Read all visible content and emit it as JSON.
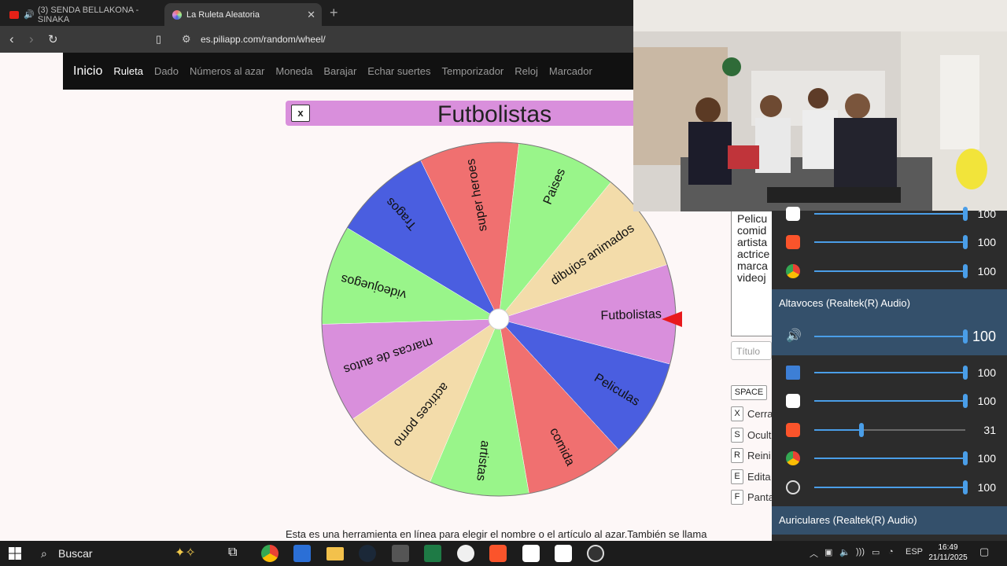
{
  "browser": {
    "tabs": [
      {
        "label": "(3) SENDA BELLAKONA - SINAKA",
        "active": false
      },
      {
        "label": "La Ruleta Aleatoria",
        "active": true
      }
    ],
    "new_tab": "+",
    "url": "es.piliapp.com/random/wheel/"
  },
  "site_nav": {
    "brand": "Inicio",
    "links": [
      "Ruleta",
      "Dado",
      "Números al azar",
      "Moneda",
      "Barajar",
      "Echar suertes",
      "Temporizador",
      "Reloj",
      "Marcador"
    ]
  },
  "wheel": {
    "close_label": "x",
    "title": "Futbolistas",
    "segments": [
      {
        "label": "Futbolistas",
        "color": "#d98fdc"
      },
      {
        "label": "Peliculas",
        "color": "#4a5ee0"
      },
      {
        "label": "comida",
        "color": "#f07070"
      },
      {
        "label": "artistas",
        "color": "#99f58a"
      },
      {
        "label": "actrices porno",
        "color": "#f3dcaa"
      },
      {
        "label": "marcas de autos",
        "color": "#d98fdc"
      },
      {
        "label": "videojuegos",
        "color": "#99f58a"
      },
      {
        "label": "Tragos",
        "color": "#4a5ee0"
      },
      {
        "label": "super heroes",
        "color": "#f07070"
      },
      {
        "label": "Paises",
        "color": "#99f58a"
      },
      {
        "label": "dibujos animados",
        "color": "#f3dcaa"
      }
    ],
    "pointer_color": "#e8191c"
  },
  "description": "Esta es una herramienta en línea para elegir el nombre o el artículo al azar.También se llama",
  "right_panel": {
    "options_text": [
      "Pelicu",
      "comid",
      "artista",
      "actrice",
      "marca",
      "videoj"
    ],
    "title_placeholder": "Título",
    "shortcuts": [
      {
        "key": "SPACE",
        "label": ""
      },
      {
        "key": "X",
        "label": "Cerra"
      },
      {
        "key": "S",
        "label": "Ocult"
      },
      {
        "key": "R",
        "label": "Reini"
      },
      {
        "key": "E",
        "label": "Edita"
      },
      {
        "key": "F",
        "label": "Panta"
      }
    ]
  },
  "mixer": {
    "rows": [
      {
        "icon": "capcut-icon",
        "value": "100",
        "level": 100
      },
      {
        "icon": "brave-icon",
        "value": "100",
        "level": 100
      },
      {
        "icon": "chrome-icon",
        "value": "100",
        "level": 100
      }
    ],
    "device1": "Altavoces (Realtek(R) Audio)",
    "master": {
      "icon": "speaker-icon",
      "value": "100",
      "level": 100
    },
    "device_rows": [
      {
        "icon": "system-sounds-icon",
        "value": "100",
        "level": 100
      },
      {
        "icon": "capcut-icon",
        "value": "100",
        "level": 100
      },
      {
        "icon": "brave-icon",
        "value": "31",
        "level": 31
      },
      {
        "icon": "chrome-icon",
        "value": "100",
        "level": 100
      },
      {
        "icon": "obs-icon",
        "value": "100",
        "level": 100
      }
    ],
    "device2": "Auriculares (Realtek(R) Audio)"
  },
  "taskbar": {
    "search": "Buscar",
    "lang": "ESP",
    "time": "16:49",
    "date": "21/11/2025"
  }
}
